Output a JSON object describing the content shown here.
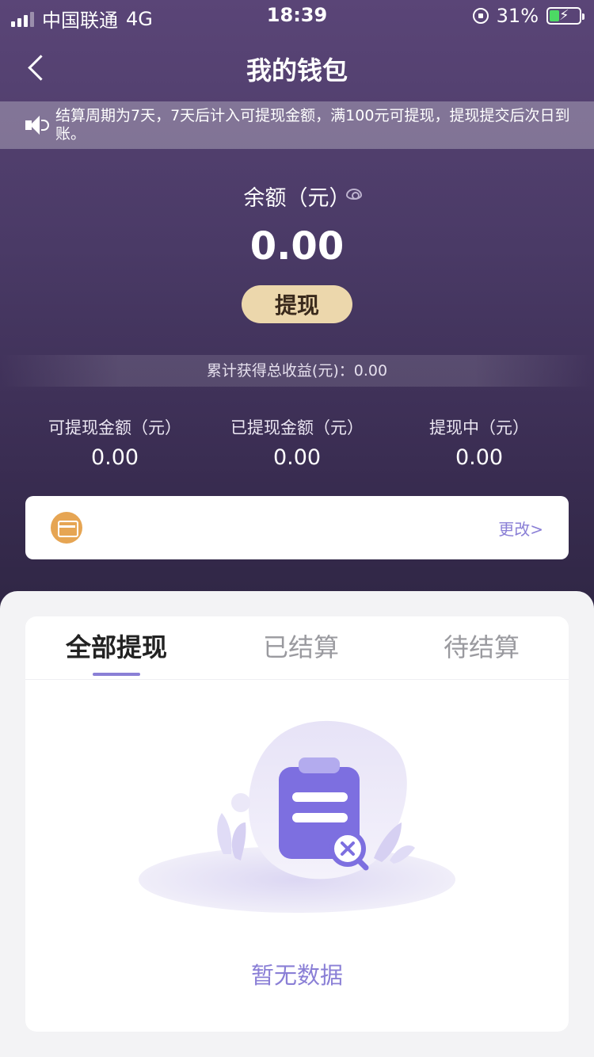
{
  "status_bar": {
    "carrier": "中国联通",
    "network": "4G",
    "time": "18:39",
    "battery": "31%"
  },
  "nav": {
    "title": "我的钱包"
  },
  "notice": {
    "text": "结算周期为7天，7天后计入可提现金额，满100元可提现，提现提交后次日到账。"
  },
  "balance": {
    "label": "余额（元）",
    "amount": "0.00",
    "withdraw_label": "提现"
  },
  "total_earnings": "累计获得总收益(元)：0.00",
  "stats": [
    {
      "label": "可提现金额（元）",
      "value": "0.00"
    },
    {
      "label": "已提现金额（元）",
      "value": "0.00"
    },
    {
      "label": "提现中（元）",
      "value": "0.00"
    }
  ],
  "account_card": {
    "change_label": "更改>"
  },
  "tabs": [
    {
      "label": "全部提现",
      "active": true
    },
    {
      "label": "已结算",
      "active": false
    },
    {
      "label": "待结算",
      "active": false
    }
  ],
  "empty_state": {
    "text": "暂无数据"
  },
  "colors": {
    "accent": "#8a7fd6",
    "button_bg": "#ecd7ac",
    "wallet_icon": "#e6a553"
  }
}
